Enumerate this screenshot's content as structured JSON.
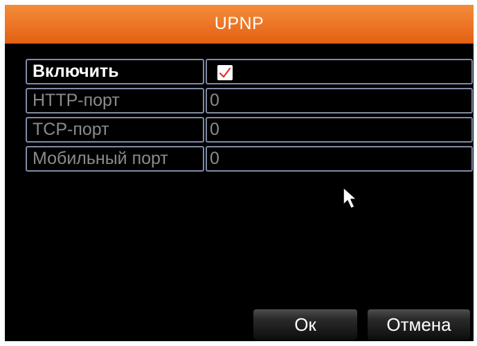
{
  "dialog": {
    "title": "UPNP"
  },
  "fields": [
    {
      "label": "Включить",
      "type": "checkbox",
      "checked": true
    },
    {
      "label": "HTTP-порт",
      "value": "0"
    },
    {
      "label": "TCP-порт",
      "value": "0"
    },
    {
      "label": "Мобильный порт",
      "value": "0"
    }
  ],
  "buttons": {
    "ok": "Ок",
    "cancel": "Отмена"
  },
  "icons": {
    "checkbox": "checkmark-icon",
    "pointer": "mouse-cursor-icon"
  },
  "colors": {
    "title_bar": "#ec7424",
    "background": "#000000",
    "field_border": "#7f8ba6",
    "checkmark": "#e0301e",
    "label_active": "#ffffff",
    "label_inactive": "#8b8b8b"
  }
}
